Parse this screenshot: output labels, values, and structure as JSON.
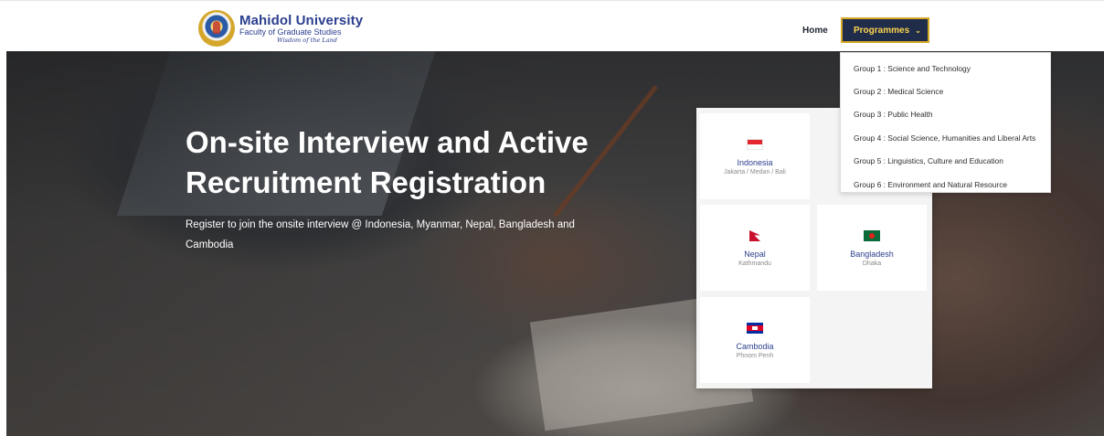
{
  "header": {
    "logo": {
      "title": "Mahidol University",
      "subtitle": "Faculty of Graduate Studies",
      "motto": "Wisdom of the Land",
      "seal_icon": "mahidol-seal-icon"
    },
    "nav": {
      "home": "Home",
      "programmes": "Programmes",
      "programmes_icon": "chevron-down-icon"
    }
  },
  "dropdown": {
    "items": [
      "Group 1 : Science and Technology",
      "Group 2 : Medical Science",
      "Group 3 : Public Health",
      "Group 4 : Social Science, Humanities and Liberal Arts",
      "Group 5 : Linguistics, Culture and Education",
      "Group 6 : Environment and Natural Resource"
    ]
  },
  "hero": {
    "title": "On-site Interview and Active Recruitment Registration",
    "subtitle": "Register to join the onsite interview @ Indonesia, Myanmar, Nepal, Bangladesh and Cambodia"
  },
  "countries": [
    {
      "name": "Indonesia",
      "cities": "Jakarta / Medan / Bali",
      "flag_icon": "indonesia-flag-icon"
    },
    {
      "name": "Nepal",
      "cities": "Kathmandu",
      "flag_icon": "nepal-flag-icon"
    },
    {
      "name": "Bangladesh",
      "cities": "Dhaka",
      "flag_icon": "bangladesh-flag-icon"
    },
    {
      "name": "Cambodia",
      "cities": "Phnom Penh",
      "flag_icon": "cambodia-flag-icon"
    }
  ],
  "colors": {
    "brand_navy": "#2b3f8e",
    "nav_button_bg": "#1f2d4a",
    "nav_button_gold": "#d6a826"
  }
}
